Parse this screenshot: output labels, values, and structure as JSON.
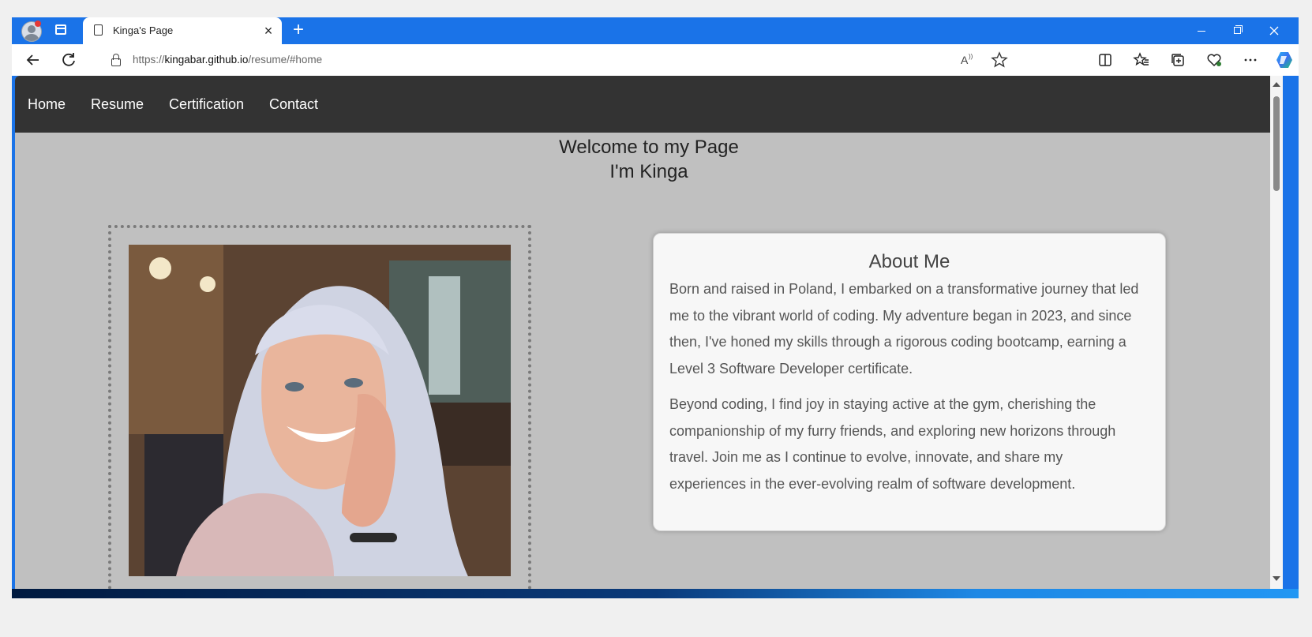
{
  "browser": {
    "tab_title": "Kinga's Page",
    "tab_close": "×",
    "new_tab": "+",
    "url_scheme": "https://",
    "url_host": "kingabar.github.io",
    "url_path": "/resume/#home",
    "toolbar_icons": [
      "back-icon",
      "refresh-icon",
      "read-aloud-icon",
      "favorite-star-icon",
      "split-screen-icon",
      "favorites-icon",
      "collections-icon",
      "browser-essentials-icon",
      "more-icon",
      "copilot-icon"
    ]
  },
  "nav": {
    "items": [
      {
        "label": "Home"
      },
      {
        "label": "Resume"
      },
      {
        "label": "Certification"
      },
      {
        "label": "Contact"
      }
    ]
  },
  "hero": {
    "line1": "Welcome to my Page",
    "line2": "I'm Kinga"
  },
  "about": {
    "title": "About Me",
    "paragraph1": "Born and raised in Poland, I embarked on a transformative journey that led me to the vibrant world of coding. My adventure began in 2023, and since then, I've honed my skills through a rigorous coding bootcamp, earning a Level 3 Software Developer certificate.",
    "paragraph2": "Beyond coding, I find joy in staying active at the gym, cherishing the companionship of my furry friends, and exploring new horizons through travel. Join me as I continue to evolve, innovate, and share my experiences in the ever-evolving realm of software development."
  },
  "colors": {
    "browser_accent": "#1a73e8",
    "navbar_bg": "#333333",
    "page_bg": "#c0c0c0",
    "card_bg": "#f7f7f7"
  }
}
